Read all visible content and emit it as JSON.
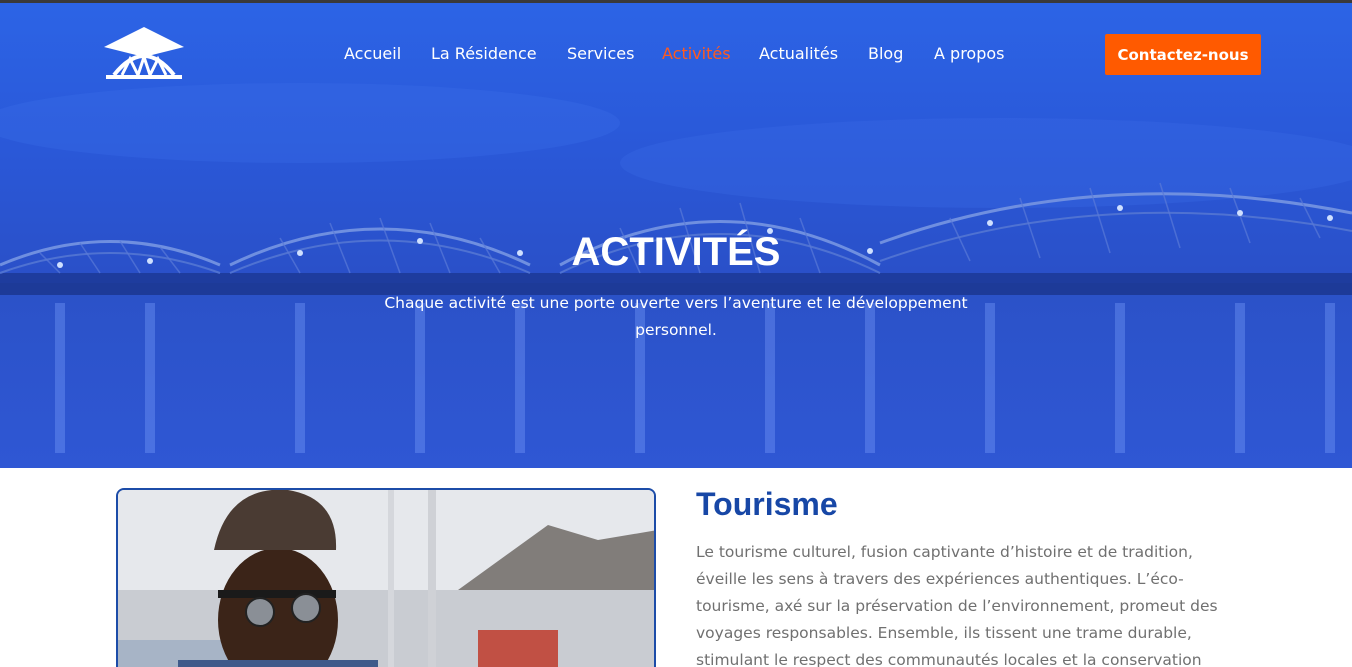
{
  "header": {
    "logo_icon": "dome-arch-logo",
    "nav": [
      {
        "label": "Accueil",
        "active": false
      },
      {
        "label": "La Résidence",
        "active": false
      },
      {
        "label": "Services",
        "active": false
      },
      {
        "label": "Activités",
        "active": true
      },
      {
        "label": "Actualités",
        "active": false
      },
      {
        "label": "Blog",
        "active": false
      },
      {
        "label": "A propos",
        "active": false
      }
    ],
    "cta_label": "Contactez-nous"
  },
  "hero": {
    "title": "ACTIVITÉS",
    "subtitle": "Chaque activité est une porte ouverte vers l’aventure et le développement personnel."
  },
  "section": {
    "title": "Tourisme",
    "text": "Le tourisme culturel, fusion captivante d’histoire et de tradition, éveille les sens à travers des expériences authentiques. L’éco-tourisme, axé sur la préservation de l’environnement, promeut des voyages responsables. Ensemble, ils tissent une trame durable, stimulant le respect des communautés locales et la conservation"
  },
  "colors": {
    "accent": "#ff5a00",
    "active_nav": "#ff5a1f",
    "heading_blue": "#1747a6",
    "hero_blue": "#2455d6",
    "body_text": "#707070"
  }
}
